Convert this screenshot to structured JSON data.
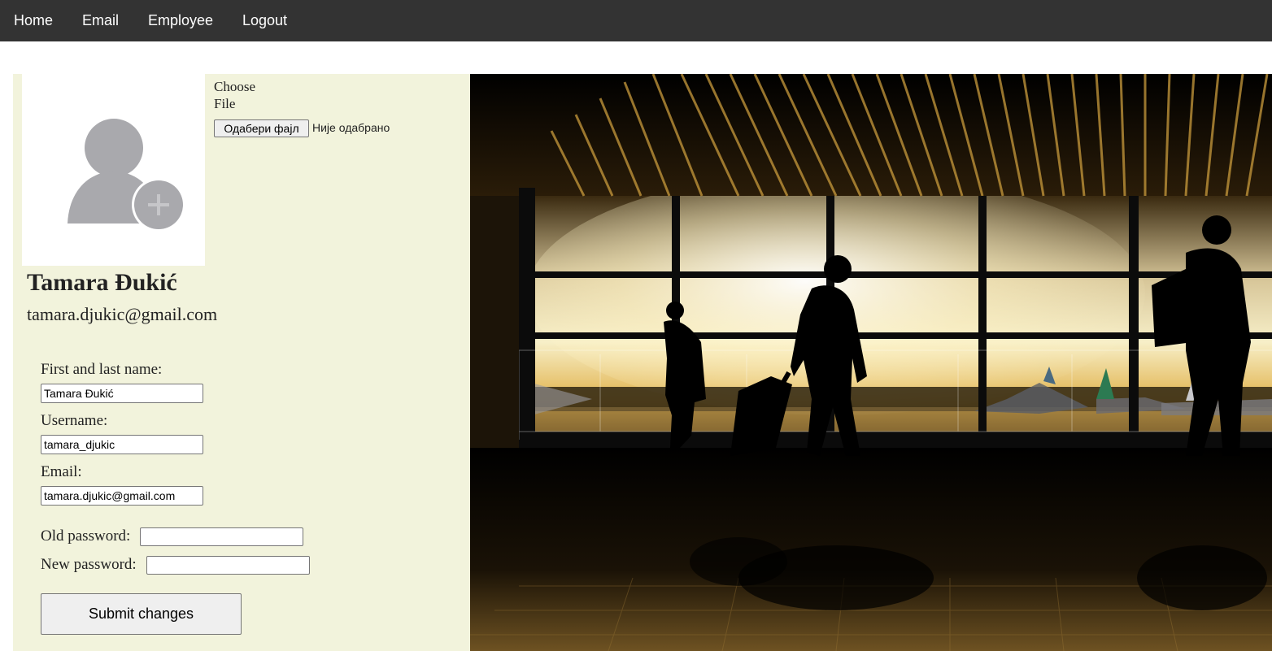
{
  "nav": {
    "items": [
      {
        "label": "Home"
      },
      {
        "label": "Email"
      },
      {
        "label": "Employee"
      },
      {
        "label": "Logout"
      }
    ]
  },
  "profile": {
    "avatar_icon": "add-user-icon",
    "choose_file_label": "Choose File",
    "file_button_label": "Одабери фајл",
    "file_status": "Није одабрано",
    "name": "Tamara Đukić",
    "email": "tamara.djukic@gmail.com"
  },
  "form": {
    "name_label": "First and last name:",
    "name_value": "Tamara Đukić",
    "username_label": "Username:",
    "username_value": "tamara_djukic",
    "email_label": "Email:",
    "email_value": "tamara.djukic@gmail.com",
    "old_password_label": "Old password:",
    "old_password_value": "",
    "new_password_label": "New password:",
    "new_password_value": "",
    "submit_label": "Submit changes"
  },
  "colors": {
    "nav_bg": "#333333",
    "panel_bg": "#f2f3dc",
    "avatar_gray": "#a9a9ad"
  }
}
